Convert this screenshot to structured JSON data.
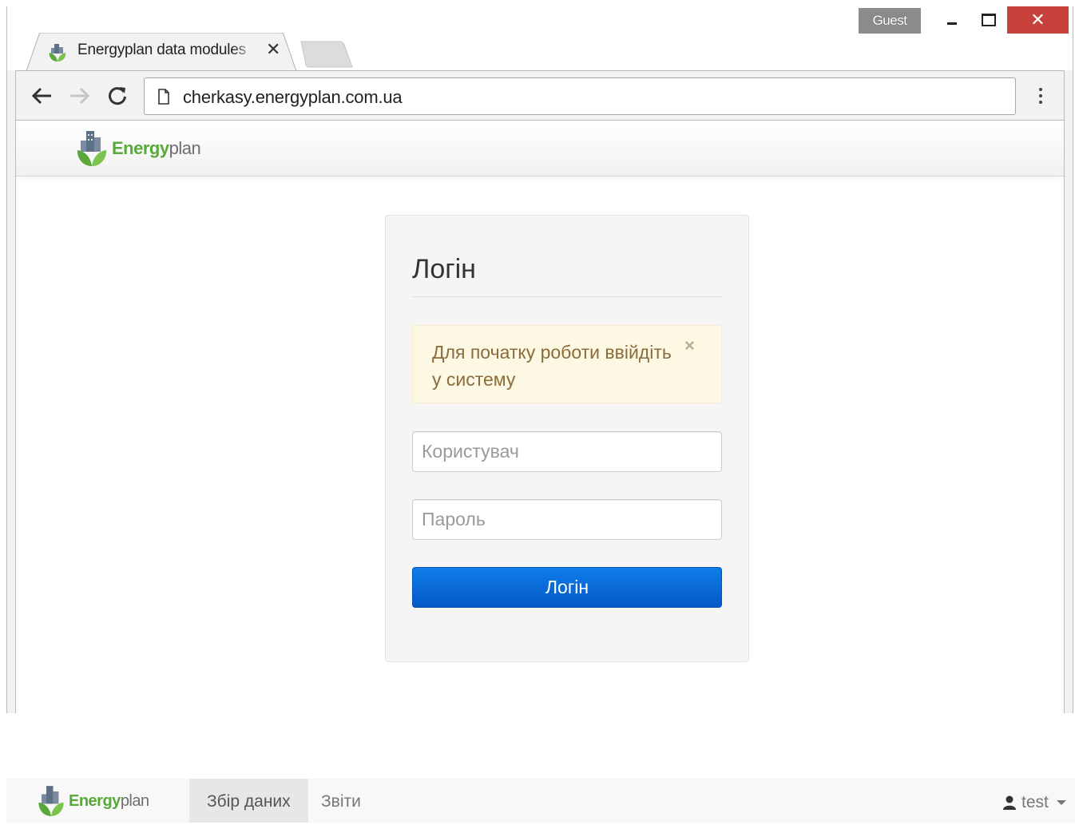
{
  "browser": {
    "profile_badge": "Guest",
    "tab": {
      "title": "Energyplan data modules",
      "favicon": "energyplan-logo-icon"
    },
    "url": "cherkasy.energyplan.com.ua",
    "icons": {
      "back": "arrow-left-icon",
      "forward": "arrow-right-icon",
      "reload": "reload-icon",
      "page": "page-icon",
      "menu": "vertical-dots-icon",
      "minimize": "minimize-icon",
      "maximize": "maximize-icon",
      "close": "close-icon"
    }
  },
  "site": {
    "brand_bold": "Energy",
    "brand_light": "plan",
    "colors": {
      "brand_green": "#5aa83a",
      "primary_blue": "#0558c8",
      "alert_bg": "#fcf8e3",
      "alert_text": "#8a6d3b"
    }
  },
  "login": {
    "heading": "Логін",
    "alert_text": "Для початку роботи ввійдіть у систему",
    "alert_close": "×",
    "username_placeholder": "Користувач",
    "password_placeholder": "Пароль",
    "button_label": "Логін"
  },
  "bottom_nav": {
    "brand_bold": "Energy",
    "brand_light": "plan",
    "items": [
      {
        "label": "Збір даних",
        "active": true
      },
      {
        "label": "Звіти",
        "active": false
      }
    ],
    "user": {
      "name": "test",
      "icon": "user-icon"
    }
  }
}
